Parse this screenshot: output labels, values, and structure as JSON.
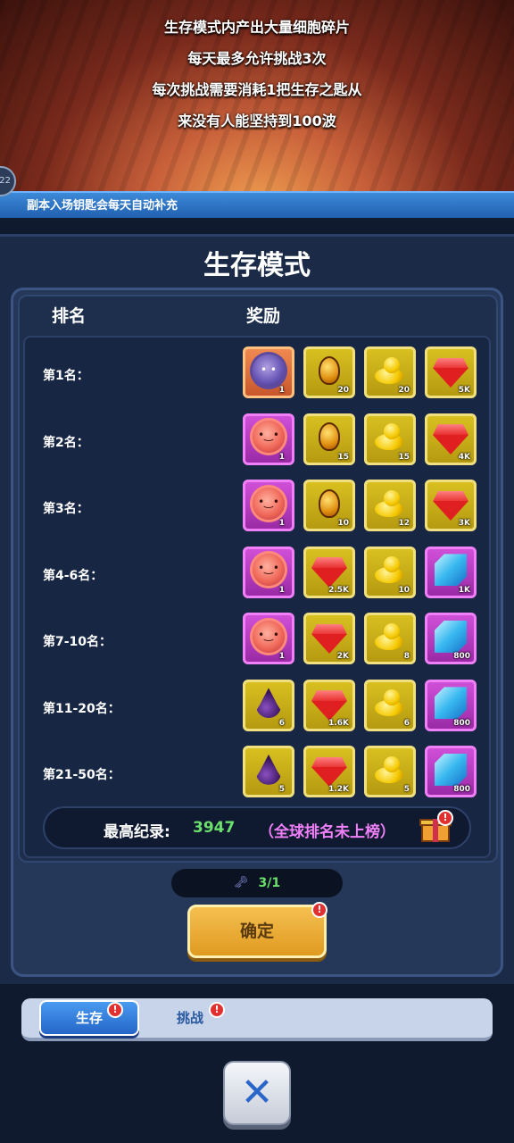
{
  "banner": {
    "lines": [
      "生存模式内产出大量细胞碎片",
      "每天最多允许挑战3次",
      "每次挑战需要消耗1把生存之匙从",
      "来没有人能坚持到100波"
    ],
    "side_badge": "22"
  },
  "notice": "副本入场钥匙会每天自动补充",
  "panel": {
    "title": "生存模式",
    "header_rank": "排名",
    "header_reward": "奖励"
  },
  "rows": [
    {
      "rank": "第1名：",
      "rewards": [
        {
          "icon": "virus-icon",
          "frame": "orange",
          "qty": "1"
        },
        {
          "icon": "egg-icon",
          "frame": "gold",
          "qty": "20"
        },
        {
          "icon": "duck-icon",
          "frame": "gold",
          "qty": "20"
        },
        {
          "icon": "ruby-icon",
          "frame": "gold",
          "qty": "5K"
        }
      ]
    },
    {
      "rank": "第2名：",
      "rewards": [
        {
          "icon": "germ-icon",
          "frame": "purple",
          "qty": "1"
        },
        {
          "icon": "egg-icon",
          "frame": "gold",
          "qty": "15"
        },
        {
          "icon": "duck-icon",
          "frame": "gold",
          "qty": "15"
        },
        {
          "icon": "ruby-icon",
          "frame": "gold",
          "qty": "4K"
        }
      ]
    },
    {
      "rank": "第3名：",
      "rewards": [
        {
          "icon": "germ-icon",
          "frame": "purple",
          "qty": "1"
        },
        {
          "icon": "egg-icon",
          "frame": "gold",
          "qty": "10"
        },
        {
          "icon": "duck-icon",
          "frame": "gold",
          "qty": "12"
        },
        {
          "icon": "ruby-icon",
          "frame": "gold",
          "qty": "3K"
        }
      ]
    },
    {
      "rank": "第4-6名：",
      "rewards": [
        {
          "icon": "germ-icon",
          "frame": "purple",
          "qty": "1"
        },
        {
          "icon": "ruby-icon",
          "frame": "gold",
          "qty": "2.5K"
        },
        {
          "icon": "duck-icon",
          "frame": "gold",
          "qty": "10"
        },
        {
          "icon": "sapphire-icon",
          "frame": "purple",
          "qty": "1K"
        }
      ]
    },
    {
      "rank": "第7-10名：",
      "rewards": [
        {
          "icon": "germ-icon",
          "frame": "purple",
          "qty": "1"
        },
        {
          "icon": "ruby-icon",
          "frame": "gold",
          "qty": "2K"
        },
        {
          "icon": "duck-icon",
          "frame": "gold",
          "qty": "8"
        },
        {
          "icon": "sapphire-icon",
          "frame": "purple",
          "qty": "800"
        }
      ]
    },
    {
      "rank": "第11-20名：",
      "rewards": [
        {
          "icon": "drop-icon",
          "frame": "gold",
          "qty": "6"
        },
        {
          "icon": "ruby-icon",
          "frame": "gold",
          "qty": "1.6K"
        },
        {
          "icon": "duck-icon",
          "frame": "gold",
          "qty": "6"
        },
        {
          "icon": "sapphire-icon",
          "frame": "purple",
          "qty": "800"
        }
      ]
    },
    {
      "rank": "第21-50名：",
      "rewards": [
        {
          "icon": "drop-icon",
          "frame": "gold",
          "qty": "5"
        },
        {
          "icon": "ruby-icon",
          "frame": "gold",
          "qty": "1.2K"
        },
        {
          "icon": "duck-icon",
          "frame": "gold",
          "qty": "5"
        },
        {
          "icon": "sapphire-icon",
          "frame": "purple",
          "qty": "800"
        }
      ]
    }
  ],
  "record": {
    "label": "最高纪录:",
    "value": "3947",
    "rank_status": "（全球排名未上榜）"
  },
  "keys": {
    "icon": "key-icon",
    "count": "3/1"
  },
  "confirm_label": "确定",
  "alert_mark": "!",
  "tabs": {
    "survival": "生存",
    "challenge": "挑战"
  },
  "close_label": "✕",
  "colors": {
    "accent": "#2466c8",
    "record_value": "#6be06b",
    "rank_status": "#f080f8",
    "confirm": "#e09a20"
  }
}
